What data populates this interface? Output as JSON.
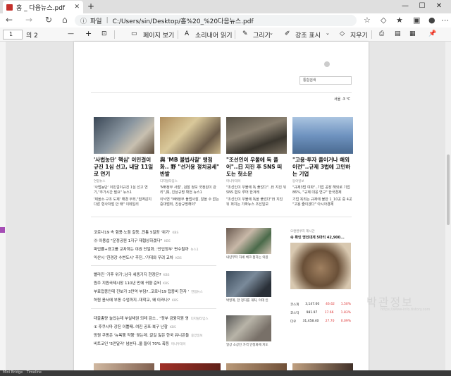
{
  "tab": {
    "title": "홈 _ 다음뉴스.pdf",
    "new_tab": "+"
  },
  "window": {
    "minimize": "—",
    "maximize": "☐",
    "close": "✕"
  },
  "address": {
    "prefix": "파일",
    "url": "C:/Users/sin/Desktop/홈%20_%20다음뉴스.pdf"
  },
  "pdf_toolbar": {
    "page_current": "1",
    "page_total": "의 2",
    "minus": "—",
    "plus": "+",
    "fit": "페이지 보기",
    "read_aloud": "소리내어 읽기",
    "draw": "그리기",
    "highlight": "강조 표시",
    "erase": "지우기"
  },
  "page": {
    "search_placeholder": "통합검색",
    "weather": "서울 -3 ℃",
    "headlines": [
      {
        "title": "'사법농단' 핵심' 이민걸이규진 1심 선고, 내달 11일로 연기",
        "source": "연합뉴스",
        "sub": "'사법농단' 이민걸이규진 1심 선고 연기,\"추가시간 필요\" 뉴스1",
        "sub2": "'제을소·구조 도제' 해경 무죄,\"칩역감지 다른 형사처벌 안 돼\" 이데일리",
        "color": "#5a6a7a"
      },
      {
        "title": "與 'MB 불법사찰' 맹점화.. 野 \"선거용 정치공세\" 반발",
        "source": "디지털타임스",
        "sub": "'MB정부 사찰', 검찰 정보 국정원이 관리\",與, 진상규명 확전 뉴스1",
        "sub2": "이낙연 \"MB정부 불법사찰, 알을 수 없는 중대범죄, 진상규명해야\"",
        "color": "#8a7a5a"
      },
      {
        "title": "\"조선인이 우물에 독 풀어\"..日 지진 후 SNS 떠도는 헛소문",
        "source": "머니투데이",
        "sub": "\"조선인이 우물에 독 풀었다\"..日 지진 뒤 SNS 혐오 루머 한겨레",
        "sub2": "\"조선인이 우물에 독을 풀었다\"日 지진 뒤 퍼지는 가짜뉴스 조선일보",
        "color": "#6a6458"
      },
      {
        "title": "\"고용·투자 줄이거나 해외 이전\"..규제 3법에 고민하는 기업",
        "source": "동아일보",
        "sub": "\"규제3법 여파\"..기업 공장 해외로 기업 86%, \"규제 대응 연구\" 한국경제",
        "sub2": "기업 옥죄는 규제에 불만 1_10곳 중 4곳 \"고용 줄이겠다\" 아시아경제",
        "color": "#7d9ab8"
      }
    ],
    "list_a": [
      {
        "text": "코로나19 속 험용·노점 갈등..전통 5일장 '위기'",
        "src": "KBS"
      },
      {
        "text": "⓪ 이용섭 \"운정공원 1지구 재협상하겠다\"",
        "src": "KBS"
      },
      {
        "text": "파업률+경고를 교차하는 야권 단일화..'안입정부' 변수될까",
        "src": "뉴스1"
      },
      {
        "text": "익산시 '한경강 수변도시' 추진..'기대와 우려 교차",
        "src": "KBS"
      }
    ],
    "list_b": [
      {
        "text": "빨라진 '기후 위기',남극 세종기지 현장은?",
        "src": "KBS"
      },
      {
        "text": "원주 지원국제시장 110년 만에 귀향 준비",
        "src": "KBS"
      },
      {
        "text": "부료접종인데 진보가 3만억 부담?..코로나19 접종비 한자 '",
        "src": "연합뉴스"
      },
      {
        "text": "허원 윤서에 부동 수업까지..대학교, 왜 이러나?",
        "src": "KBS"
      }
    ],
    "list_c": [
      {
        "text": "대출총량 늘었는데 부실채권 되레 감소.. \"정부 금융지원 영",
        "src": "디지털타임스"
      },
      {
        "text": "① 후쿠시마 강진 이틀째..여진 공포·복구 난항",
        "src": "KBS"
      },
      {
        "text": "망원 쿠팡은 '뉴욕행 직행' 맞는데..갈길 잃은 한국 유니콘들",
        "src": "중앙일보"
      },
      {
        "text": "비트코인 '5만달러' 넘본다..올 들어 70% 폭등",
        "src": "머니투데이"
      }
    ],
    "captions": [
      "내년부터 자세 체크 접하는 의원",
      "박영계, 한 정치를 개최, 이데 인",
      "일상 소상인 가격 안정화에 지도"
    ],
    "ad": {
      "label": "오랜엔쿠치 제시간",
      "title": "속 확인 명인대게 5마리 42,900..."
    },
    "stocks": [
      {
        "name": "코스피",
        "value": "3,147.00",
        "diff": "46.62",
        "pct": "1.50%"
      },
      {
        "name": "코스닥",
        "value": "981.97",
        "diff": "17.66",
        "pct": "1.83%"
      },
      {
        "name": "다우",
        "value": "31,458.40",
        "diff": "27.70",
        "pct": "0.09%"
      }
    ]
  },
  "watermark": {
    "main": "박관정보",
    "url": "https://www-info.tistory.com"
  },
  "bottom": {
    "left": "Mini Bridge",
    "right": "Timeline"
  }
}
